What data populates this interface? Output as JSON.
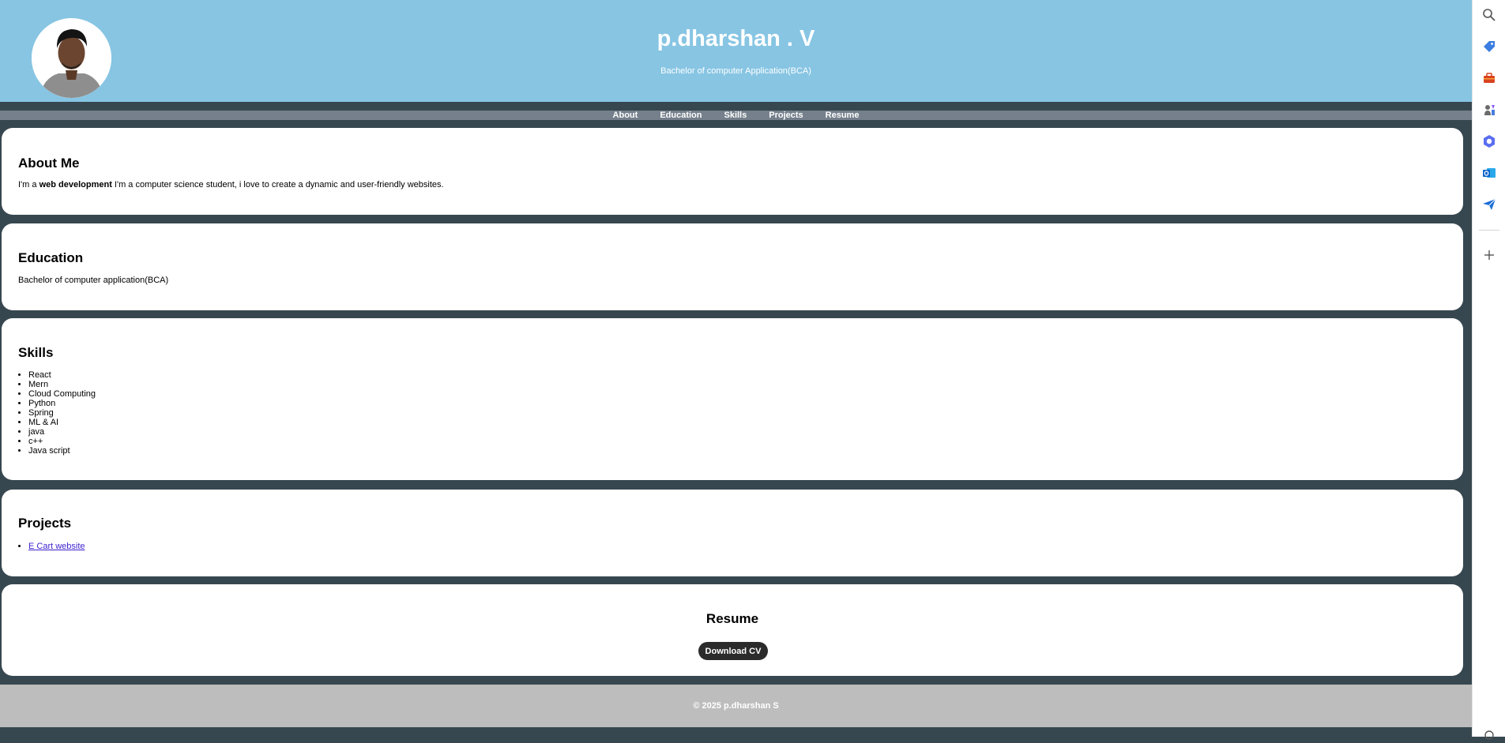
{
  "header": {
    "name": "p.dharshan . V",
    "subtitle": "Bachelor of computer Application(BCA)"
  },
  "nav": {
    "items": [
      "About",
      "Education",
      "Skills",
      "Projects",
      "Resume"
    ]
  },
  "about": {
    "heading": "About Me",
    "text_pre": "I'm a ",
    "text_bold": "web development",
    "text_post": " I'm a computer science student, i love to create a dynamic and user-friendly websites."
  },
  "education": {
    "heading": "Education",
    "text": "Bachelor of computer application(BCA)"
  },
  "skills": {
    "heading": "Skills",
    "items": [
      "React",
      "Mern",
      "Cloud Computing",
      "Python",
      "Spring",
      "ML & AI",
      "java",
      "c++",
      "Java script"
    ]
  },
  "projects": {
    "heading": "Projects",
    "items": [
      "E Cart website"
    ]
  },
  "resume": {
    "heading": "Resume",
    "button_label": "Download CV"
  },
  "footer": {
    "text": "© 2025 p.dharshan S"
  },
  "sidebar_icons": [
    "search-icon",
    "tag-icon",
    "toolbox-icon",
    "chess-icon",
    "copilot-icon",
    "outlook-icon",
    "send-icon",
    "add-icon"
  ],
  "colors": {
    "header_bg": "#87c5e3",
    "page_bg": "#37474f",
    "nav_bg": "#75808c",
    "footer_bg": "#bdbdbd",
    "button_bg": "#2b2b2b",
    "link": "#3d1fcf"
  }
}
